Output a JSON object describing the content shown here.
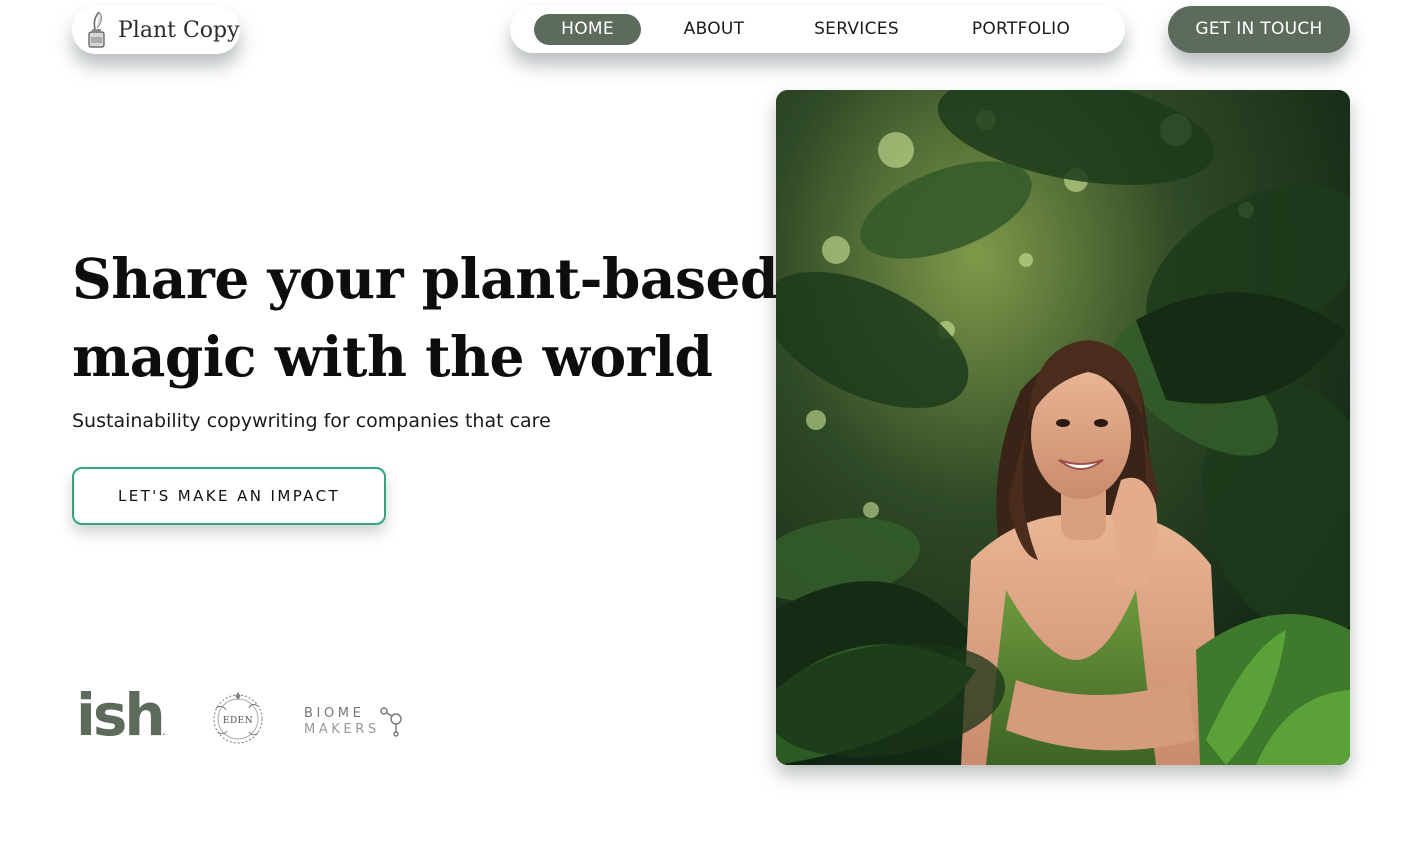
{
  "header": {
    "logo": {
      "text": "Plant Copy",
      "icon": "ink-bottle-quill-icon"
    },
    "nav": [
      {
        "label": "HOME",
        "active": true
      },
      {
        "label": "ABOUT",
        "active": false
      },
      {
        "label": "SERVICES",
        "active": false
      },
      {
        "label": "PORTFOLIO",
        "active": false
      }
    ],
    "cta_label": "GET IN TOUCH"
  },
  "hero": {
    "title_line1": "Share your plant-based",
    "title_line2": "magic with the world",
    "subtitle": "Sustainability copywriting for companies that care",
    "button_label": "LET'S MAKE AN IMPACT",
    "image": "woman-among-monstera-leaves-photo"
  },
  "clients": {
    "ish": {
      "text": "ish",
      "mark": "."
    },
    "eden": {
      "text": "EDEN"
    },
    "biome": {
      "line1": "BIOME",
      "line2": "MAKERS"
    }
  },
  "colors": {
    "brand_green": "#5d6b5d",
    "button_border": "#2fa877",
    "text_dark": "#0d0d0d",
    "background": "#ffffff"
  }
}
